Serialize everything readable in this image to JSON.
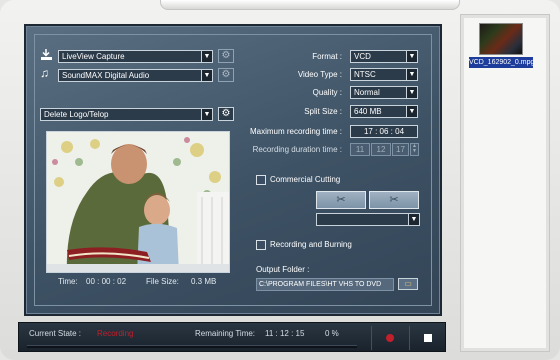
{
  "capture": {
    "video_device": "LiveView Capture",
    "audio_device": "SoundMAX Digital Audio",
    "logo_filter": "Delete Logo/Telop"
  },
  "preview": {
    "time_label": "Time:",
    "time_value": "00 : 00 : 02",
    "size_label": "File Size:",
    "size_value": "0.3 MB"
  },
  "settings": {
    "format_label": "Format :",
    "format_value": "VCD",
    "video_type_label": "Video Type :",
    "video_type_value": "NTSC",
    "quality_label": "Quality :",
    "quality_value": "Normal",
    "split_size_label": "Split Size :",
    "split_size_value": "640 MB",
    "max_time_label": "Maximum recording time :",
    "max_time_value": "17 : 06 : 04",
    "duration_label": "Recording duration time :",
    "duration_h": "11",
    "duration_m": "12",
    "duration_s": "17"
  },
  "commercial": {
    "label": "Commercial Cutting"
  },
  "burning": {
    "label": "Recording and Burning"
  },
  "output": {
    "label": "Output Folder :",
    "path": "C:\\PROGRAM FILES\\HT VHS TO DVD"
  },
  "status": {
    "state_label": "Current State :",
    "state_value": "Recording",
    "remaining_label": "Remaining Time:",
    "remaining_value": "11 : 12 : 15",
    "percent": "0 %",
    "progress_fraction": 0
  },
  "files": [
    {
      "name": "VCD_162902_0.mpg"
    }
  ],
  "colors": {
    "accent_red": "#c0202b",
    "selection": "#1e3c9c"
  }
}
